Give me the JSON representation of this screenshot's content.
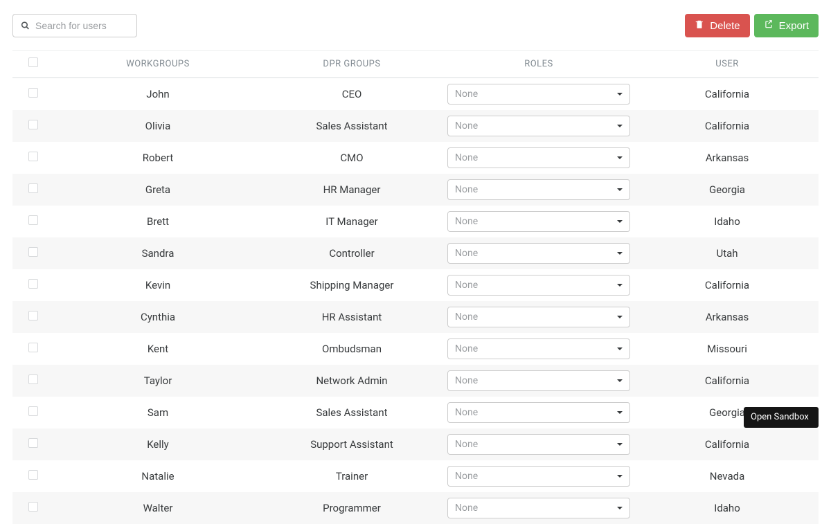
{
  "search": {
    "placeholder": "Search for users"
  },
  "buttons": {
    "delete": "Delete",
    "export": "Export"
  },
  "columns": {
    "workgroups": "WORKGROUPS",
    "dpr": "DPR GROUPS",
    "roles": "ROLES",
    "user": "USER"
  },
  "role_placeholder": "None",
  "rows": [
    {
      "workgroup": "John",
      "dpr": "CEO",
      "user": "California"
    },
    {
      "workgroup": "Olivia",
      "dpr": "Sales Assistant",
      "user": "California"
    },
    {
      "workgroup": "Robert",
      "dpr": "CMO",
      "user": "Arkansas"
    },
    {
      "workgroup": "Greta",
      "dpr": "HR Manager",
      "user": "Georgia"
    },
    {
      "workgroup": "Brett",
      "dpr": "IT Manager",
      "user": "Idaho"
    },
    {
      "workgroup": "Sandra",
      "dpr": "Controller",
      "user": "Utah"
    },
    {
      "workgroup": "Kevin",
      "dpr": "Shipping Manager",
      "user": "California"
    },
    {
      "workgroup": "Cynthia",
      "dpr": "HR Assistant",
      "user": "Arkansas"
    },
    {
      "workgroup": "Kent",
      "dpr": "Ombudsman",
      "user": "Missouri"
    },
    {
      "workgroup": "Taylor",
      "dpr": "Network Admin",
      "user": "California"
    },
    {
      "workgroup": "Sam",
      "dpr": "Sales Assistant",
      "user": "Georgia"
    },
    {
      "workgroup": "Kelly",
      "dpr": "Support Assistant",
      "user": "California"
    },
    {
      "workgroup": "Natalie",
      "dpr": "Trainer",
      "user": "Nevada"
    },
    {
      "workgroup": "Walter",
      "dpr": "Programmer",
      "user": "Idaho"
    }
  ],
  "sandbox_label": "Open Sandbox"
}
